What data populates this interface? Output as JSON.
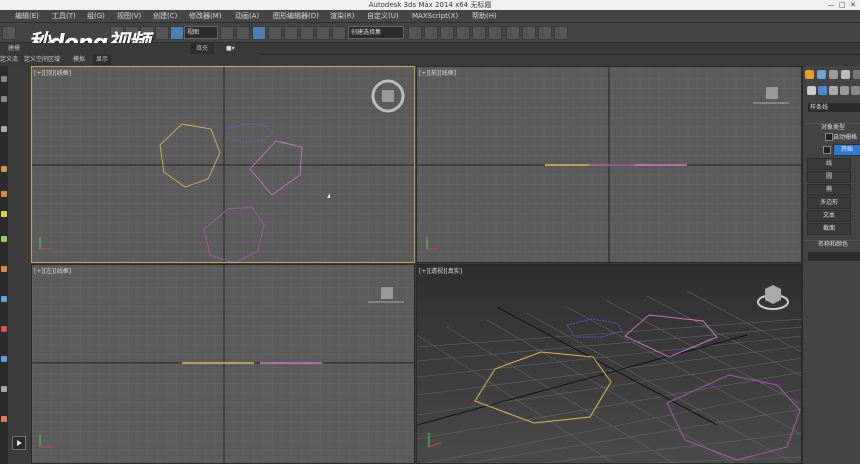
{
  "window": {
    "title": "Autodesk 3ds Max  2014 x64     无标题"
  },
  "menu": [
    "编辑(E)",
    "工具(T)",
    "组(G)",
    "视图(V)",
    "创建(C)",
    "修改器(M)",
    "动画(A)",
    "图形编辑器(D)",
    "渲染(R)",
    "自定义(U)",
    "MAXScript(X)",
    "帮助(H)"
  ],
  "toolbar": {
    "view_select": "视图",
    "selection_set": "创建选择集"
  },
  "ribbon": {
    "left_label": "建模",
    "fill_label": "填充"
  },
  "ribbon_tabs": [
    "定义流",
    "定义空间区域",
    "模拟",
    "显示"
  ],
  "watermark": {
    "text": "秒dong视频"
  },
  "viewports": [
    {
      "label": "[+][顶][线框]"
    },
    {
      "label": "[+][前][线框]"
    },
    {
      "label": "[+][左][线框]"
    },
    {
      "label": "[+][透视][真实]"
    }
  ],
  "command_panel": {
    "category": "样条线",
    "rollout_object_type": "对象类型",
    "auto_grid": "自动栅格",
    "start_new": "开始",
    "buttons": [
      "线",
      "圆",
      "椭",
      "多边形",
      "文本",
      "截面"
    ],
    "rollout_name": "名称和颜色"
  },
  "colors": {
    "active_border": "#c8a64a",
    "accent": "#2f7ad6",
    "shape_yellow": "#d8b25a",
    "shape_pink": "#c874c0",
    "shape_purple": "#6c5cc4"
  }
}
